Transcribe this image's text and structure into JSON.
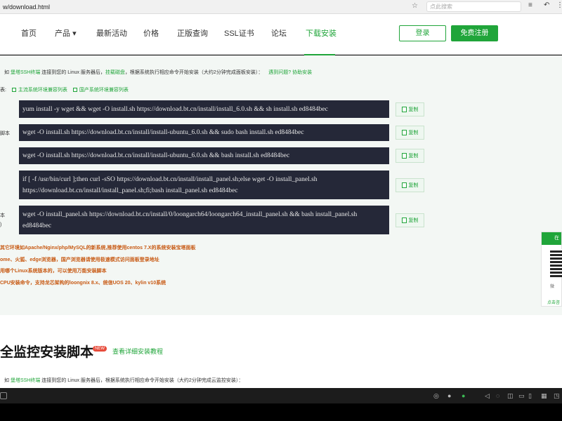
{
  "browser": {
    "url": "w/download.html",
    "search_placeholder": "点此搜索"
  },
  "nav": {
    "items": [
      "首页",
      "产品",
      "最新活动",
      "价格",
      "正版查询",
      "SSL证书",
      "论坛",
      "下载安装"
    ],
    "product_caret": "▾",
    "login": "登录",
    "register": "免费注册"
  },
  "section1": {
    "intro_prefix": "如 ",
    "intro_link1": "堡塔SSH终端",
    "intro_mid": " 连接到您的 Linux 服务器后，",
    "intro_link2": "挂载磁盘",
    "intro_rest": "，根据系统执行相应命令开始安装（大约2分钟完成面板安装）：",
    "intro_help": "遇到问题? 协助安装",
    "os_label": "表:",
    "tab1": "主流系统环境兼容列表",
    "tab2": "国产系统环境兼容列表",
    "row_labels": [
      "脚本",
      "本",
      ")"
    ],
    "commands": [
      "yum install -y wget && wget -O install.sh https://download.bt.cn/install/install_6.0.sh && sh install.sh ed8484bec",
      "wget -O install.sh https://download.bt.cn/install/install-ubuntu_6.0.sh && sudo bash install.sh ed8484bec",
      "wget -O install.sh https://download.bt.cn/install/install-ubuntu_6.0.sh && bash install.sh ed8484bec",
      "if [ -f /usr/bin/curl ];then curl -sSO https://download.bt.cn/install/install_panel.sh;else wget -O install_panel.sh https://download.bt.cn/install/install_panel.sh;fi;bash install_panel.sh ed8484bec",
      "wget -O install_panel.sh https://download.bt.cn/install/0/loongarch64/loongarch64_install_panel.sh && bash install_panel.sh ed8484bec"
    ],
    "copy_label": "复制",
    "notes": [
      "其它环境如Apache/Nginx/php/MySQL的新系统,推荐使用centos 7.X的系统安装宝塔面板",
      "ome、火狐、edge浏览器，国产浏览器请使用极速模式访问面板登录地址",
      "用哪个Linux系统版本的，可以使用万能安装脚本",
      "CPU安装命令，支持龙芯架构的loongnix 8.x、统信UOS 20、kylin v10系统"
    ]
  },
  "section2": {
    "title": "全监控安装脚本",
    "badge": "NEW",
    "tutorial_link": "查看详细安装教程",
    "intro_prefix": "如 ",
    "intro_link": "堡塔SSH终端",
    "intro_rest": " 连接到您的 Linux 服务器后，根据系统执行相应命令开始安装（大约2分钟完成云监控安装）："
  },
  "side_widget": {
    "header": "在",
    "text1": "微",
    "text2": "点击咨"
  },
  "colors": {
    "brand_green": "#20a53a",
    "terminal_bg": "#252838",
    "note_orange": "#c85a14"
  }
}
